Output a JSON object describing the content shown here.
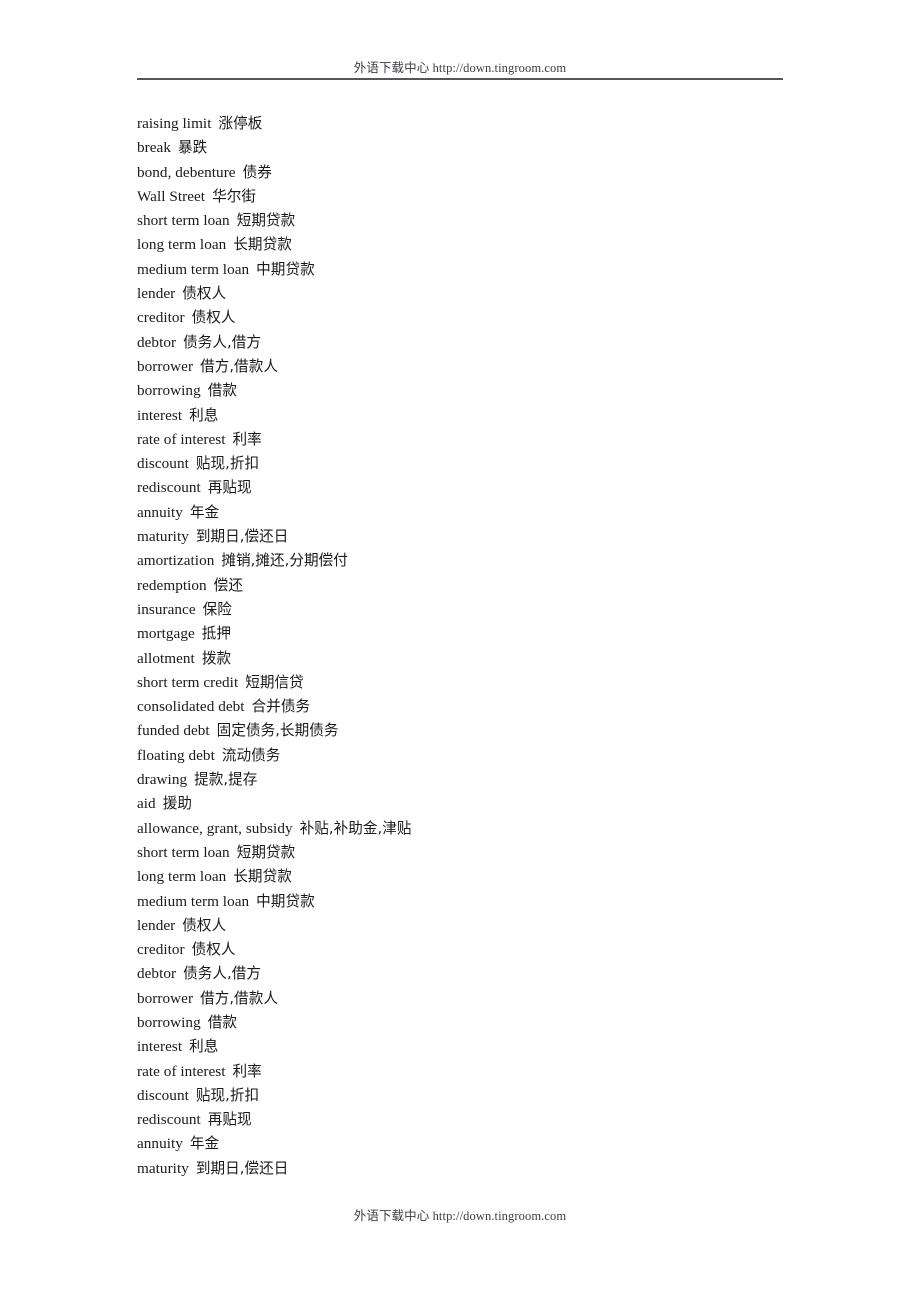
{
  "header": {
    "text": "外语下载中心 http://down.tingroom.com",
    "rule_color": "#55555f"
  },
  "footer": {
    "text": "外语下载中心 http://down.tingroom.com"
  },
  "document": {
    "entries": [
      {
        "en": "raising limit",
        "zh": "涨停板"
      },
      {
        "en": "break",
        "zh": "暴跌"
      },
      {
        "en": "bond, debenture",
        "zh": "债券"
      },
      {
        "en": "Wall Street",
        "zh": "华尔街"
      },
      {
        "en": "short term loan",
        "zh": "短期贷款"
      },
      {
        "en": "long term loan",
        "zh": "长期贷款"
      },
      {
        "en": "medium term loan",
        "zh": "中期贷款"
      },
      {
        "en": "lender",
        "zh": "债权人"
      },
      {
        "en": "creditor",
        "zh": "债权人"
      },
      {
        "en": "debtor",
        "zh": "债务人,借方"
      },
      {
        "en": "borrower",
        "zh": "借方,借款人"
      },
      {
        "en": "borrowing",
        "zh": "借款"
      },
      {
        "en": "interest",
        "zh": "利息"
      },
      {
        "en": "rate of interest",
        "zh": "利率"
      },
      {
        "en": "discount",
        "zh": "贴现,折扣"
      },
      {
        "en": "rediscount",
        "zh": "再贴现"
      },
      {
        "en": "annuity",
        "zh": "年金"
      },
      {
        "en": "maturity",
        "zh": "到期日,偿还日"
      },
      {
        "en": "amortization",
        "zh": "摊销,摊还,分期偿付"
      },
      {
        "en": "redemption",
        "zh": "偿还"
      },
      {
        "en": "insurance",
        "zh": "保险"
      },
      {
        "en": "mortgage",
        "zh": "抵押"
      },
      {
        "en": "allotment",
        "zh": "拨款"
      },
      {
        "en": "short term credit",
        "zh": "短期信贷"
      },
      {
        "en": "consolidated debt",
        "zh": "合并债务"
      },
      {
        "en": "funded debt",
        "zh": "固定债务,长期债务"
      },
      {
        "en": "floating debt",
        "zh": "流动债务"
      },
      {
        "en": "drawing",
        "zh": "提款,提存"
      },
      {
        "en": "aid",
        "zh": "援助"
      },
      {
        "en": "allowance, grant, subsidy",
        "zh": "补贴,补助金,津贴"
      },
      {
        "en": "short term loan",
        "zh": "短期贷款"
      },
      {
        "en": "long term loan",
        "zh": "长期贷款"
      },
      {
        "en": "medium term loan",
        "zh": "中期贷款"
      },
      {
        "en": "lender",
        "zh": "债权人"
      },
      {
        "en": "creditor",
        "zh": "债权人"
      },
      {
        "en": "debtor",
        "zh": "债务人,借方"
      },
      {
        "en": "borrower",
        "zh": "借方,借款人"
      },
      {
        "en": "borrowing",
        "zh": "借款"
      },
      {
        "en": "interest",
        "zh": "利息"
      },
      {
        "en": "rate of interest",
        "zh": "利率"
      },
      {
        "en": "discount",
        "zh": "贴现,折扣"
      },
      {
        "en": "rediscount",
        "zh": "再贴现"
      },
      {
        "en": "annuity",
        "zh": "年金"
      },
      {
        "en": "maturity",
        "zh": "到期日,偿还日"
      }
    ]
  }
}
